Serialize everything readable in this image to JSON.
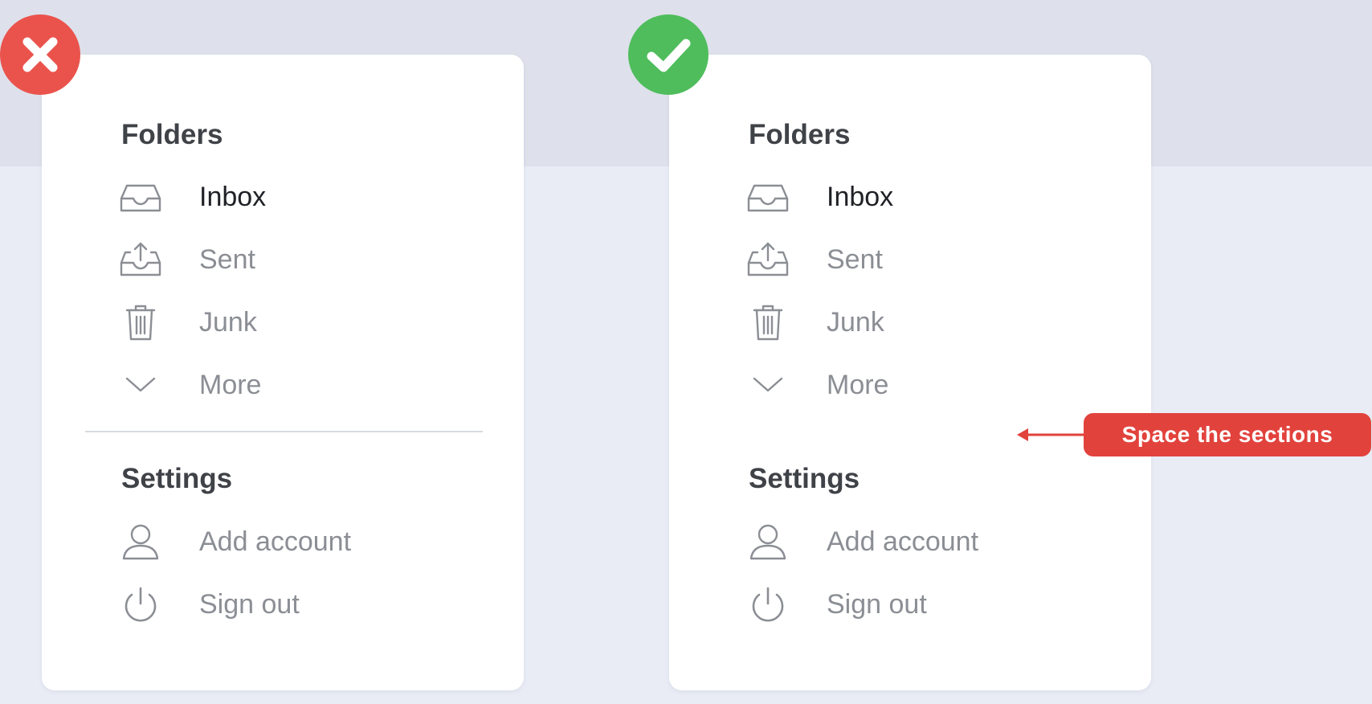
{
  "bad_example": {
    "folders_title": "Folders",
    "settings_title": "Settings",
    "folders": [
      {
        "label": "Inbox",
        "icon": "inbox-icon"
      },
      {
        "label": "Sent",
        "icon": "sent-icon"
      },
      {
        "label": "Junk",
        "icon": "trash-icon"
      },
      {
        "label": "More",
        "icon": "chevron-down-icon"
      }
    ],
    "settings": [
      {
        "label": "Add account",
        "icon": "user-icon"
      },
      {
        "label": "Sign out",
        "icon": "power-icon"
      }
    ],
    "badge_icon": "cross-icon",
    "badge_color": "#ea534c"
  },
  "good_example": {
    "folders_title": "Folders",
    "settings_title": "Settings",
    "folders": [
      {
        "label": "Inbox",
        "icon": "inbox-icon"
      },
      {
        "label": "Sent",
        "icon": "sent-icon"
      },
      {
        "label": "Junk",
        "icon": "trash-icon"
      },
      {
        "label": "More",
        "icon": "chevron-down-icon"
      }
    ],
    "settings": [
      {
        "label": "Add account",
        "icon": "user-icon"
      },
      {
        "label": "Sign out",
        "icon": "power-icon"
      }
    ],
    "badge_icon": "check-icon",
    "badge_color": "#4fbd5c"
  },
  "callout": {
    "text": "Space the sections",
    "color": "#e2423c"
  },
  "colors": {
    "active_text": "#1f2126",
    "muted_text": "#8b8e94",
    "heading_text": "#3f4247",
    "background": "#e9ecf5",
    "card": "#ffffff"
  }
}
